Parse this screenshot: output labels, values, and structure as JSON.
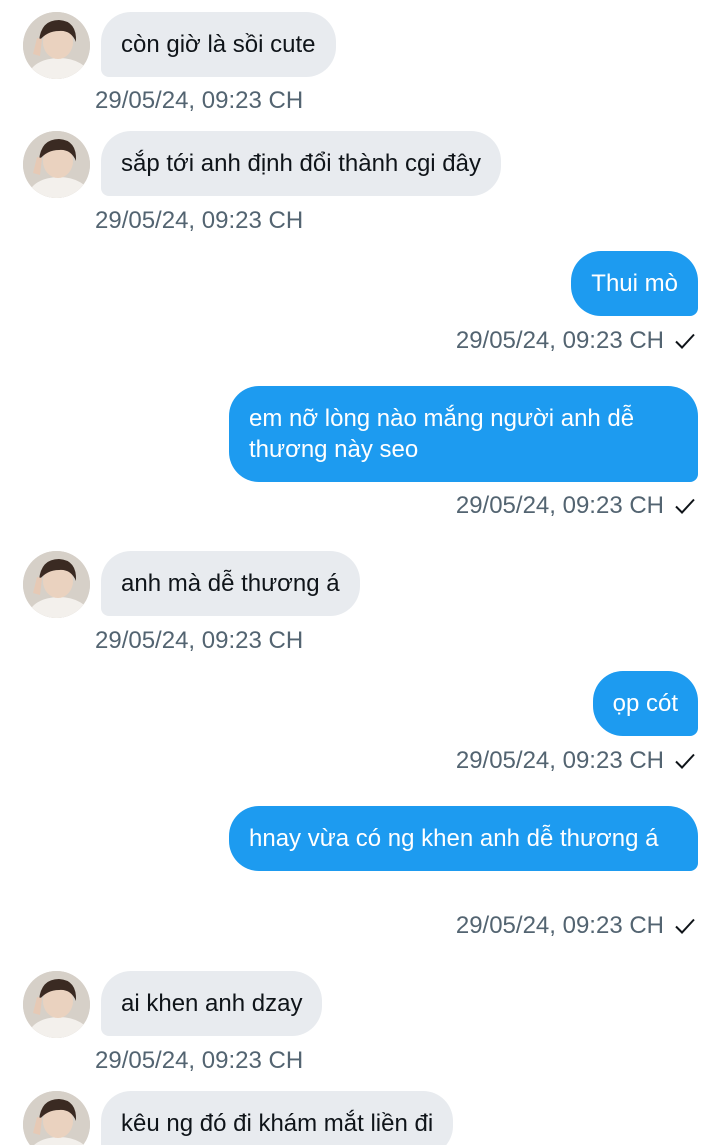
{
  "conversation": {
    "messages": [
      {
        "direction": "in",
        "text": "còn giờ là sồi cute",
        "timestamp": "29/05/24, 09:23 CH"
      },
      {
        "direction": "in",
        "text": "sắp tới anh định đổi thành cgi đây",
        "timestamp": "29/05/24, 09:23 CH"
      },
      {
        "direction": "out",
        "text": "Thui mò",
        "timestamp": "29/05/24, 09:23 CH",
        "status_icon": "check-icon"
      },
      {
        "direction": "out",
        "text": "em nỡ lòng nào mắng người anh dễ thương này seo",
        "timestamp": "29/05/24, 09:23 CH",
        "status_icon": "check-icon"
      },
      {
        "direction": "in",
        "text": "anh mà dễ thương á",
        "timestamp": "29/05/24, 09:23 CH"
      },
      {
        "direction": "out",
        "text": "ọp cót",
        "timestamp": "29/05/24, 09:23 CH",
        "status_icon": "check-icon"
      },
      {
        "direction": "out",
        "text": "hnay vừa có ng khen anh dễ thương á",
        "timestamp": "29/05/24, 09:23 CH",
        "status_icon": "check-icon"
      },
      {
        "direction": "in",
        "text": "ai khen anh dzay",
        "timestamp": "29/05/24, 09:23 CH"
      },
      {
        "direction": "in",
        "text": "kêu ng đó đi khám mắt liền đi",
        "timestamp": ""
      }
    ]
  },
  "colors": {
    "outgoing_bubble": "#1d9bf0",
    "incoming_bubble": "#e8ebef",
    "timestamp_text": "#536471"
  }
}
